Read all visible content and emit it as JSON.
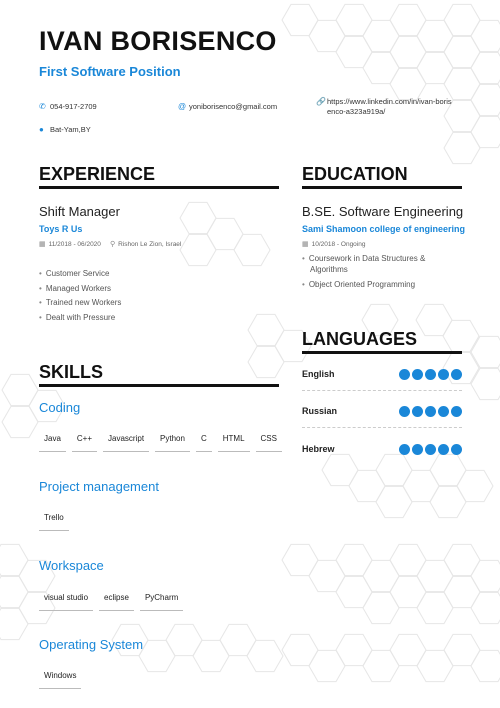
{
  "header": {
    "name": "IVAN BORISENCO",
    "headline": "First Software Position"
  },
  "contact": {
    "phone": "054-917-2709",
    "email": "yoniborisenco@gmail.com",
    "linkedin_line1": "https://www.linkedin.com/in/ivan-boris",
    "linkedin_line2": "enco-a323a919a/",
    "location": "Bat-Yam,BY"
  },
  "experience": {
    "title": "EXPERIENCE",
    "job_title": "Shift Manager",
    "company": "Toys R Us",
    "dates": "11/2018 - 06/2020",
    "location": "Rishon Le Zion, Israel",
    "bullets": [
      "Customer Service",
      "Managed Workers",
      "Trained new Workers",
      "Dealt with Pressure"
    ]
  },
  "skills": {
    "title": "SKILLS",
    "categories": [
      {
        "name": "Coding",
        "items": [
          "Java",
          "C++",
          "Javascript",
          "Python",
          "C",
          "HTML",
          "CSS"
        ]
      },
      {
        "name": "Project management",
        "items": [
          "Trello"
        ]
      },
      {
        "name": "Workspace",
        "items": [
          "visual studio",
          "eclipse",
          "PyCharm"
        ]
      },
      {
        "name": "Operating System",
        "items": [
          "Windows"
        ]
      }
    ]
  },
  "education": {
    "title": "EDUCATION",
    "degree": "B.SE. Software Engineering",
    "school": "Sami Shamoon college of engineering",
    "dates": "10/2018 - Ongoing",
    "bullets": [
      "Coursework in Data Structures & Algorithms",
      "Object Oriented Programming"
    ]
  },
  "languages": {
    "title": "LANGUAGES",
    "items": [
      {
        "name": "English",
        "level": 5,
        "max": 5
      },
      {
        "name": "Russian",
        "level": 5,
        "max": 5
      },
      {
        "name": "Hebrew",
        "level": 5,
        "max": 5
      }
    ]
  },
  "colors": {
    "accent": "#1a87d8",
    "text": "#111111",
    "muted": "#555555"
  },
  "icons": {
    "phone": "phone-icon",
    "email": "at-icon",
    "link": "link-icon",
    "location": "pin-icon",
    "calendar": "calendar-icon"
  }
}
